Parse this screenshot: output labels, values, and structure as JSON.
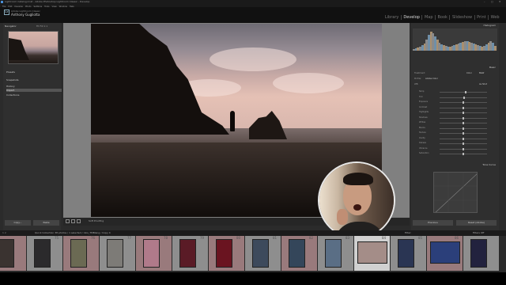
{
  "window": {
    "title": "Lightroom Catalog.lrcat - Adobe Photoshop Lightroom Classic - Develop",
    "minimize": "–",
    "maximize": "□",
    "close": "✕"
  },
  "menu": [
    "File",
    "Edit",
    "Develop",
    "Photo",
    "Settings",
    "Tools",
    "View",
    "Window",
    "Help"
  ],
  "identity": {
    "logo": "Lr",
    "line1": "Adobe Lightroom Classic",
    "line2": "Anthony Gugliotta"
  },
  "modules": [
    {
      "label": "Library",
      "active": false
    },
    {
      "label": "Develop",
      "active": true
    },
    {
      "label": "Map",
      "active": false
    },
    {
      "label": "Book",
      "active": false
    },
    {
      "label": "Slideshow",
      "active": false
    },
    {
      "label": "Print",
      "active": false
    },
    {
      "label": "Web",
      "active": false
    }
  ],
  "left_panel": {
    "navigator_label": "Navigator",
    "navigator_zoom": "Fit  Fill  1:1",
    "presets": "Presets",
    "snapshots": "Snapshots",
    "history": "History",
    "history_item": "Import",
    "collections": "Collections",
    "copy_button": "Copy...",
    "paste_button": "Paste"
  },
  "toolbar": {
    "soft_proofing": "Soft Proofing"
  },
  "right_panel": {
    "histogram": "Histogram",
    "basic": "Basic",
    "treatment": "Treatment:",
    "color": "Color",
    "bw": "B&W",
    "profile": "Profile:",
    "profile_value": "Adobe Color",
    "wb": "WB:",
    "wb_value": "As Shot",
    "tone_curve": "Tone Curve",
    "sliders": [
      {
        "label": "Temp",
        "level": 0.55
      },
      {
        "label": "Tint",
        "level": 0.52
      },
      {
        "label": "Exposure",
        "level": 0.5
      },
      {
        "label": "Contrast",
        "level": 0.5
      },
      {
        "label": "Highlights",
        "level": 0.5
      },
      {
        "label": "Shadows",
        "level": 0.5
      },
      {
        "label": "Whites",
        "level": 0.5
      },
      {
        "label": "Blacks",
        "level": 0.5
      },
      {
        "label": "Texture",
        "level": 0.5
      },
      {
        "label": "Clarity",
        "level": 0.5
      },
      {
        "label": "Dehaze",
        "level": 0.5
      },
      {
        "label": "Vibrance",
        "level": 0.5
      },
      {
        "label": "Saturation",
        "level": 0.5
      }
    ],
    "previous_button": "Previous",
    "reset_button": "Reset (Adobe)"
  },
  "filmstrip_bar": {
    "nums": "1  2",
    "path": "Quick Collection   38 photos / 1 selected / niko_TMBlang / Copy 4",
    "filter": "Filter:",
    "filter_value": "Filters Off"
  },
  "filmstrip": [
    {
      "num": "",
      "color": "#3a3330",
      "wide": false,
      "sel": false
    },
    {
      "num": "75",
      "color": "#2b2a2c",
      "wide": false,
      "sel": false
    },
    {
      "num": "76",
      "color": "#6b6a53",
      "wide": false,
      "sel": false
    },
    {
      "num": "77",
      "color": "#7d7b77",
      "wide": false,
      "sel": false
    },
    {
      "num": "78",
      "color": "#b07a8a",
      "wide": false,
      "sel": false
    },
    {
      "num": "79",
      "color": "#5a1b26",
      "wide": false,
      "sel": false
    },
    {
      "num": "80",
      "color": "#6a1420",
      "wide": false,
      "sel": false
    },
    {
      "num": "81",
      "color": "#3d4a5c",
      "wide": false,
      "sel": false
    },
    {
      "num": "82",
      "color": "#34465a",
      "wide": false,
      "sel": false
    },
    {
      "num": "83",
      "color": "#5a6e85",
      "wide": false,
      "sel": false
    },
    {
      "num": "84",
      "color": "#a48d88",
      "wide": true,
      "sel": true
    },
    {
      "num": "85",
      "color": "#2a3553",
      "wide": false,
      "sel": false
    },
    {
      "num": "86",
      "color": "#2b3f7a",
      "wide": true,
      "sel": false
    },
    {
      "num": "",
      "color": "#22223e",
      "wide": false,
      "sel": false
    }
  ],
  "colors": {
    "accent": "#4a90d9",
    "panel": "#2f2f2f",
    "stage": "#808080"
  }
}
